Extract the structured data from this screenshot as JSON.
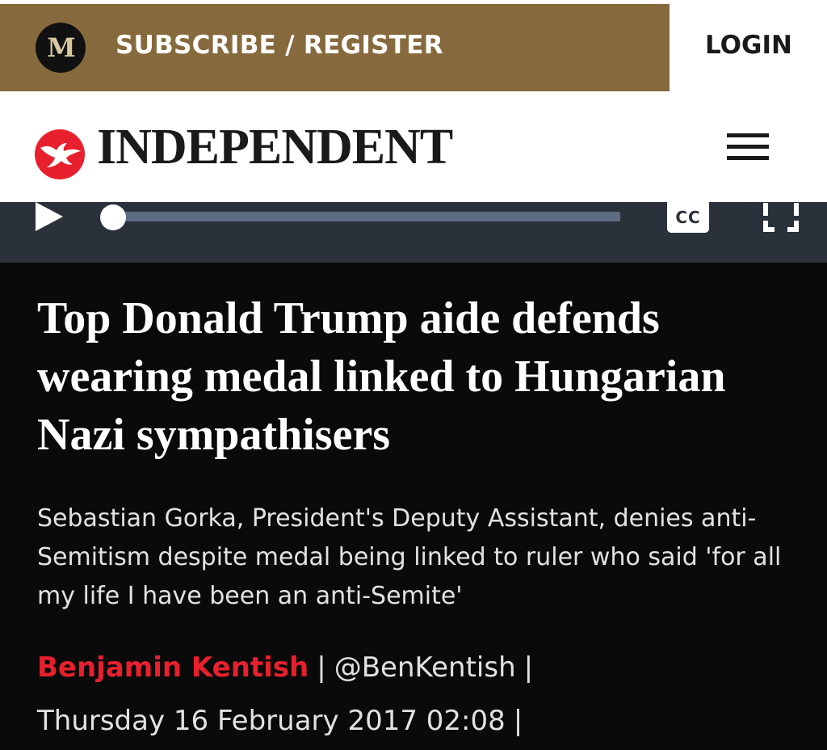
{
  "premium_bar": {
    "logo_letter": "M",
    "subscribe_label": "SUBSCRIBE / REGISTER",
    "login_label": "LOGIN",
    "colors": {
      "gold": "#866a3d"
    }
  },
  "masthead": {
    "brand_name": "INDEPENDENT",
    "logo_icon": "eagle-icon",
    "menu_icon": "hamburger-menu-icon",
    "colors": {
      "logo_red": "#e8202e"
    }
  },
  "video_player": {
    "controls": [
      "play-icon",
      "progress-bar",
      "closed-captions-button",
      "fullscreen-icon"
    ],
    "cc_label": "CC",
    "progress_fraction": 0.01
  },
  "article": {
    "headline": "Top Donald Trump aide defends wearing medal linked to Hungarian Nazi sympathisers",
    "standfirst": "Sebastian Gorka, President's Deputy Assistant, denies anti-Semitism despite medal being linked to ruler who said 'for all my life I have been an anti-Semite'",
    "author": "Benjamin Kentish",
    "author_handle": "@BenKentish",
    "separator": "|",
    "date": "Thursday 16 February 2017 02:08",
    "colors": {
      "author": "#e8202e",
      "background": "#0a0a0a"
    }
  }
}
